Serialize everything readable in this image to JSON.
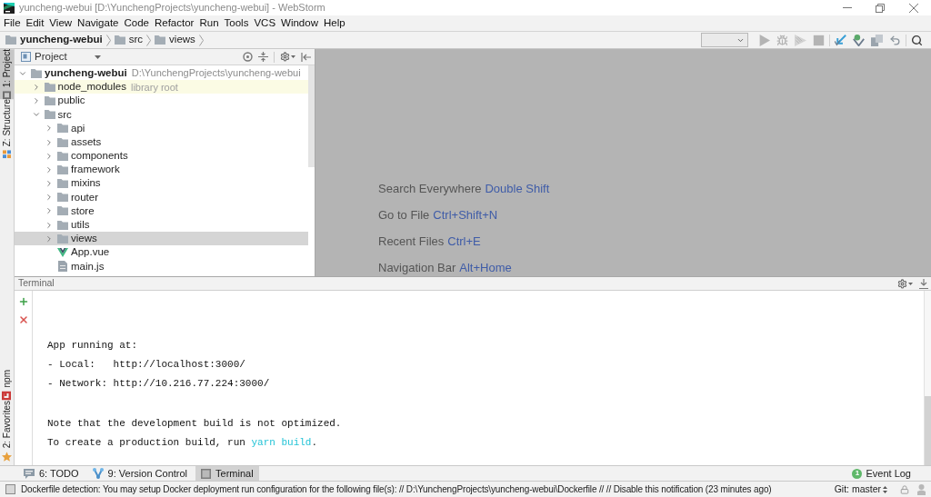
{
  "window": {
    "title": "yuncheng-webui [D:\\YunchengProjects\\yuncheng-webui] - WebStorm"
  },
  "menu": [
    "File",
    "Edit",
    "View",
    "Navigate",
    "Code",
    "Refactor",
    "Run",
    "Tools",
    "VCS",
    "Window",
    "Help"
  ],
  "breadcrumbs": [
    {
      "label": "yuncheng-webui",
      "kind": "project"
    },
    {
      "label": "src",
      "kind": "folder"
    },
    {
      "label": "views",
      "kind": "folder"
    }
  ],
  "toolbar": [
    [
      {
        "kind": "run",
        "disabled": true
      },
      {
        "kind": "debug",
        "disabled": true
      },
      {
        "kind": "coverage",
        "disabled": true
      },
      {
        "kind": "stop",
        "disabled": true
      }
    ],
    [
      {
        "kind": "update",
        "disabled": false
      },
      {
        "kind": "commit",
        "disabled": false
      },
      {
        "kind": "compare",
        "disabled": false
      },
      {
        "kind": "revert",
        "disabled": false
      }
    ],
    [
      {
        "kind": "search",
        "disabled": false
      }
    ]
  ],
  "left_strip": {
    "top": [
      {
        "label": "1: Project",
        "kind": "project",
        "selected": true
      },
      {
        "label": "Z: Structure",
        "kind": "structure",
        "selected": false
      }
    ],
    "bottom": [
      {
        "label": "npm",
        "kind": "npm",
        "selected": false
      },
      {
        "label": "2: Favorites",
        "kind": "favorites",
        "selected": false
      }
    ]
  },
  "project_panel": {
    "title": "Project",
    "tree": [
      {
        "label": "yuncheng-webui",
        "path": "D:\\YunchengProjects\\yuncheng-webui",
        "kind": "project",
        "expanded": true,
        "selected": false,
        "children": [
          {
            "label": "node_modules",
            "note": "library root",
            "kind": "library",
            "expanded": false,
            "selected": false
          },
          {
            "label": "public",
            "kind": "folder",
            "expanded": false,
            "selected": false
          },
          {
            "label": "src",
            "kind": "folder",
            "expanded": true,
            "selected": false,
            "children": [
              {
                "label": "api",
                "kind": "folder",
                "expanded": false,
                "selected": false
              },
              {
                "label": "assets",
                "kind": "folder",
                "expanded": false,
                "selected": false
              },
              {
                "label": "components",
                "kind": "folder",
                "expanded": false,
                "selected": false
              },
              {
                "label": "framework",
                "kind": "folder",
                "expanded": false,
                "selected": false
              },
              {
                "label": "mixins",
                "kind": "folder",
                "expanded": false,
                "selected": false
              },
              {
                "label": "router",
                "kind": "folder",
                "expanded": false,
                "selected": false
              },
              {
                "label": "store",
                "kind": "folder",
                "expanded": false,
                "selected": false
              },
              {
                "label": "utils",
                "kind": "folder",
                "expanded": false,
                "selected": false
              },
              {
                "label": "views",
                "kind": "folder",
                "expanded": false,
                "selected": true
              },
              {
                "label": "App.vue",
                "kind": "vue",
                "selected": false
              },
              {
                "label": "main.js",
                "kind": "js",
                "selected": false
              }
            ]
          }
        ]
      }
    ]
  },
  "editor": {
    "hints": [
      {
        "action": "Search Everywhere",
        "shortcut": "Double Shift"
      },
      {
        "action": "Go to File",
        "shortcut": "Ctrl+Shift+N"
      },
      {
        "action": "Recent Files",
        "shortcut": "Ctrl+E"
      },
      {
        "action": "Navigation Bar",
        "shortcut": "Alt+Home"
      }
    ]
  },
  "terminal": {
    "title": "Terminal",
    "blocks": [
      {
        "lines": [
          {
            "segments": [
              {
                "text": "App running at:",
                "kind": "plain"
              }
            ]
          },
          {
            "segments": [
              {
                "text": "- Local:   http://localhost:3000/",
                "kind": "plain"
              }
            ]
          },
          {
            "segments": [
              {
                "text": "- Network: http://10.216.77.224:3000/",
                "kind": "plain"
              }
            ]
          }
        ]
      },
      {
        "lines": [
          {
            "segments": [
              {
                "text": "Note that the development build is not optimized.",
                "kind": "plain"
              }
            ]
          },
          {
            "segments": [
              {
                "text": "To create a production build, run ",
                "kind": "plain"
              },
              {
                "text": "yarn build",
                "kind": "command"
              },
              {
                "text": ".",
                "kind": "plain"
              }
            ]
          }
        ]
      }
    ]
  },
  "bottom_tabs": [
    {
      "label": "6: TODO",
      "kind": "todo",
      "selected": false
    },
    {
      "label": "9: Version Control",
      "kind": "vcs",
      "selected": false
    },
    {
      "label": "Terminal",
      "kind": "terminal",
      "selected": true
    }
  ],
  "event_log": {
    "label": "Event Log",
    "badge": "1"
  },
  "status_bar": {
    "message": "Dockerfile detection: You may setup Docker deployment run configuration for the following file(s): // D:\\YunchengProjects\\yuncheng-webui\\Dockerfile // // Disable this notification (23 minutes ago)",
    "branch": "Git: master"
  }
}
